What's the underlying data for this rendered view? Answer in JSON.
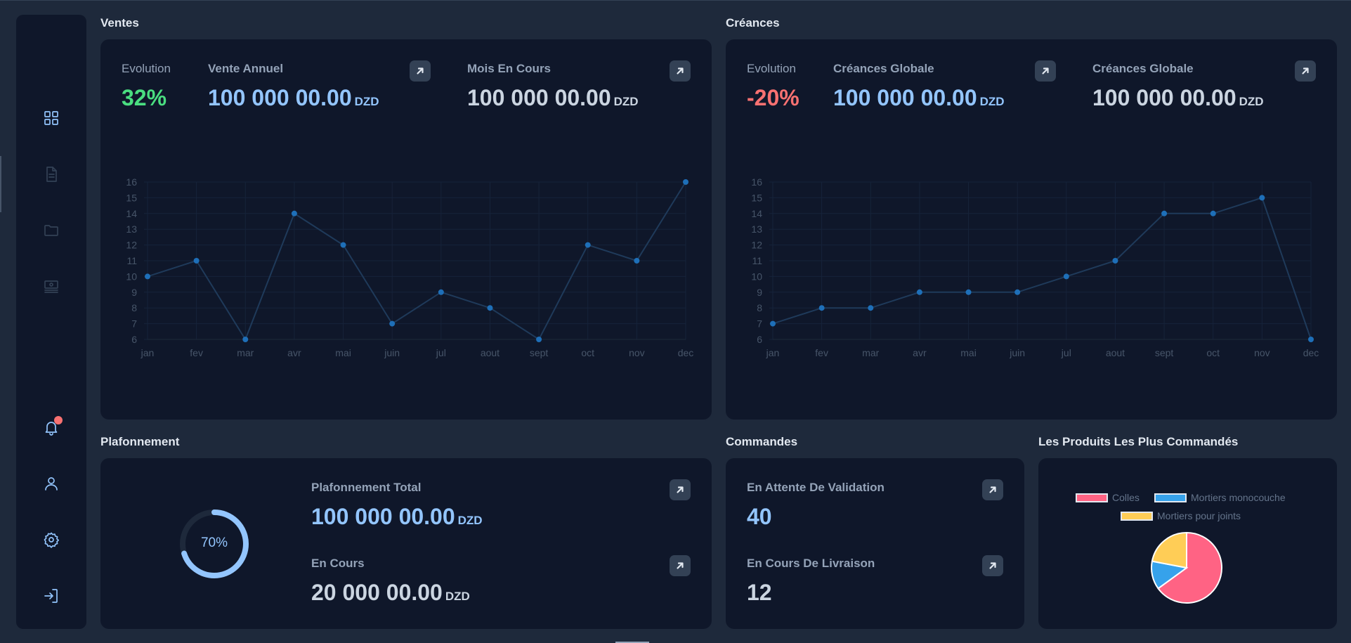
{
  "sections": {
    "ventes": "Ventes",
    "creances": "Créances",
    "plafonnement": "Plafonnement",
    "commandes": "Commandes",
    "produits": "Les Produits Les Plus Commandés"
  },
  "currency": "DZD",
  "ventes": {
    "evolution_label": "Evolution",
    "evolution_value": "32%",
    "stat1_label": "Vente Annuel",
    "stat1_value": "100 000 00.00",
    "stat2_label": "Mois En Cours",
    "stat2_value": "100 000 00.00"
  },
  "creances": {
    "evolution_label": "Evolution",
    "evolution_value": "-20%",
    "stat1_label": "Créances Globale",
    "stat1_value": "100 000 00.00",
    "stat2_label": "Créances Globale",
    "stat2_value": "100 000 00.00"
  },
  "plafonnement": {
    "progress_text": "70%",
    "progress_value": 0.7,
    "total_label": "Plafonnement Total",
    "total_value": "100 000 00.00",
    "encours_label": "En Cours",
    "encours_value": "20 000 00.00"
  },
  "commandes": {
    "attente_label": "En Attente De Validation",
    "attente_value": "40",
    "livraison_label": "En Cours De Livraison",
    "livraison_value": "12"
  },
  "colors": {
    "accent": "#93c5fd",
    "positive": "#4ade80",
    "negative": "#f87171",
    "line_point": "#1e6fb8",
    "line_stroke": "#1f3a5a"
  },
  "sidebar_icons": [
    "dashboard-icon",
    "document-icon",
    "folder-icon",
    "invoice-icon",
    "bell-icon",
    "user-icon",
    "gear-icon",
    "logout-icon"
  ],
  "chart_data": [
    {
      "type": "line",
      "x": [
        "jan",
        "fev",
        "mar",
        "avr",
        "mai",
        "juin",
        "jul",
        "aout",
        "sept",
        "oct",
        "nov",
        "dec"
      ],
      "series": [
        {
          "values": [
            10,
            11,
            6,
            14,
            12,
            7,
            9,
            8,
            6,
            12,
            11,
            16
          ]
        }
      ],
      "ylim": [
        6,
        16
      ],
      "yticks": [
        6,
        7,
        8,
        9,
        10,
        11,
        12,
        13,
        14,
        15,
        16
      ],
      "grid": true
    },
    {
      "type": "line",
      "x": [
        "jan",
        "fev",
        "mar",
        "avr",
        "mai",
        "juin",
        "jul",
        "aout",
        "sept",
        "oct",
        "nov",
        "dec"
      ],
      "series": [
        {
          "values": [
            7,
            8,
            8,
            9,
            9,
            9,
            10,
            11,
            14,
            14,
            15,
            6
          ]
        }
      ],
      "ylim": [
        6,
        16
      ],
      "yticks": [
        6,
        7,
        8,
        9,
        10,
        11,
        12,
        13,
        14,
        15,
        16
      ],
      "grid": true
    },
    {
      "type": "pie",
      "labels": [
        "Colles",
        "Mortiers monocouche",
        "Mortiers pour joints"
      ],
      "values": [
        65,
        13,
        22
      ],
      "colors": [
        "#ff6384",
        "#36a2eb",
        "#ffcd56"
      ],
      "legend": "top"
    }
  ]
}
